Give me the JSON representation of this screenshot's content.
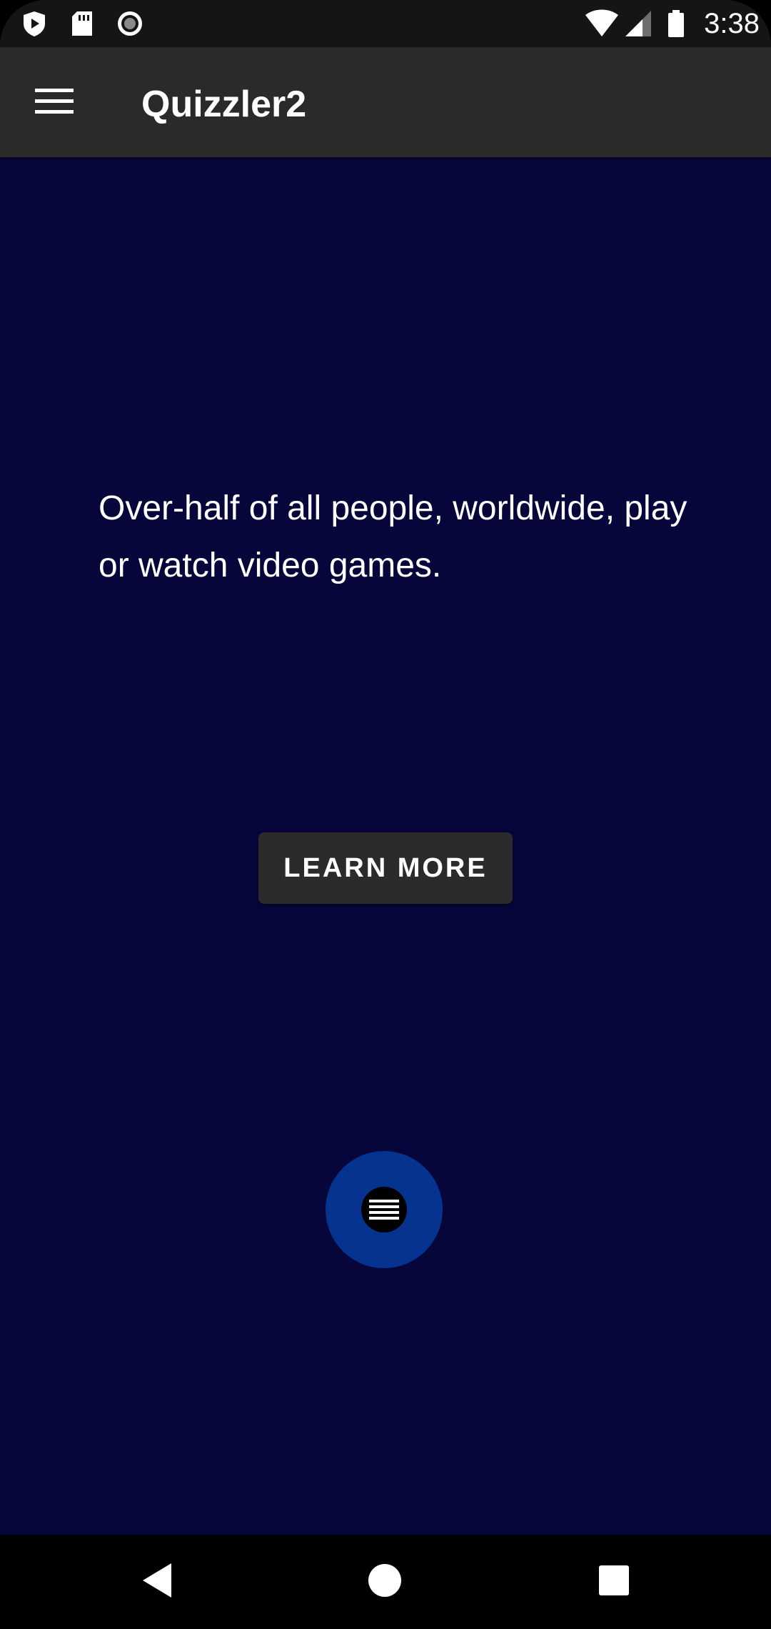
{
  "status_bar": {
    "time": "3:38",
    "left_icons": [
      "shield-play-icon",
      "sd-card-icon",
      "record-icon"
    ],
    "right_icons": [
      "wifi-icon",
      "cell-signal-icon",
      "battery-icon"
    ]
  },
  "app_bar": {
    "title": "Quizzler2",
    "menu_icon": "hamburger-menu-icon"
  },
  "content": {
    "fact": "Over-half of all people, worldwide, play or watch video games.",
    "learn_more_label": "LEARN MORE",
    "fab_icon": "menu-lines-icon"
  },
  "nav_bar": {
    "buttons": [
      "back-icon",
      "home-icon",
      "recents-icon"
    ]
  },
  "colors": {
    "background": "#06063a",
    "app_bar": "#2a2a2a",
    "status_bar": "#151515",
    "button": "#2b2b2b",
    "fab": "#05338f"
  }
}
